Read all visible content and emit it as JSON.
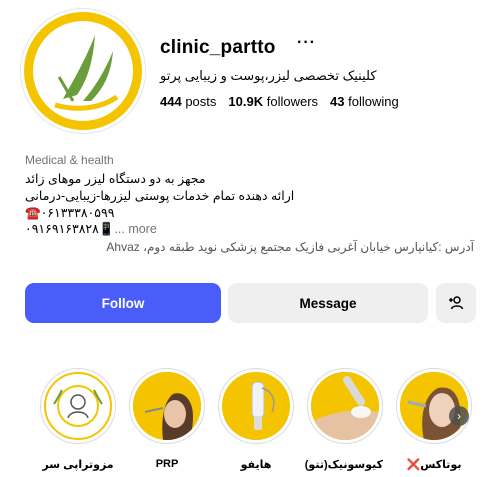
{
  "profile": {
    "username": "clinic_partto",
    "more_label": "···",
    "full_name": "کلینیک تخصصی لیزر،پوست و زیبایی پرتو",
    "stats": {
      "posts_count": "444",
      "posts_label": "posts",
      "followers_count": "10.9K",
      "followers_label": "followers",
      "following_count": "43",
      "following_label": "following"
    },
    "category": "Medical & health",
    "bio": {
      "line1": "مجهز به دو دستگاه لیزر موهای زائد",
      "line2": "ارائه دهنده تمام خدمات پوستی لیزرها-زیبایی-درمانی",
      "line3": "☎️۰۶۱۳۳۳۸۰۵۹۹",
      "line4": "۰۹۱۶۹۱۶۳۸۲۸📱",
      "more": "... more"
    },
    "address": "آدرس :کیانپارس خیابان آغربی فازیک مجتمع پزشکی نوید طبقه دوم، Ahvaz"
  },
  "actions": {
    "follow_label": "Follow",
    "message_label": "Message",
    "add_user_icon": "add-user-icon"
  },
  "highlights": [
    {
      "label": "مزوتراپی سر"
    },
    {
      "label": "PRP"
    },
    {
      "label": "هایفو"
    },
    {
      "label": "کیوسونیک(تتو)"
    },
    {
      "label": "بوتاکس",
      "mark": "❌"
    }
  ],
  "colors": {
    "accent": "#4a5df9",
    "brand_yellow": "#f5c400",
    "brand_green": "#6a9e3c"
  }
}
